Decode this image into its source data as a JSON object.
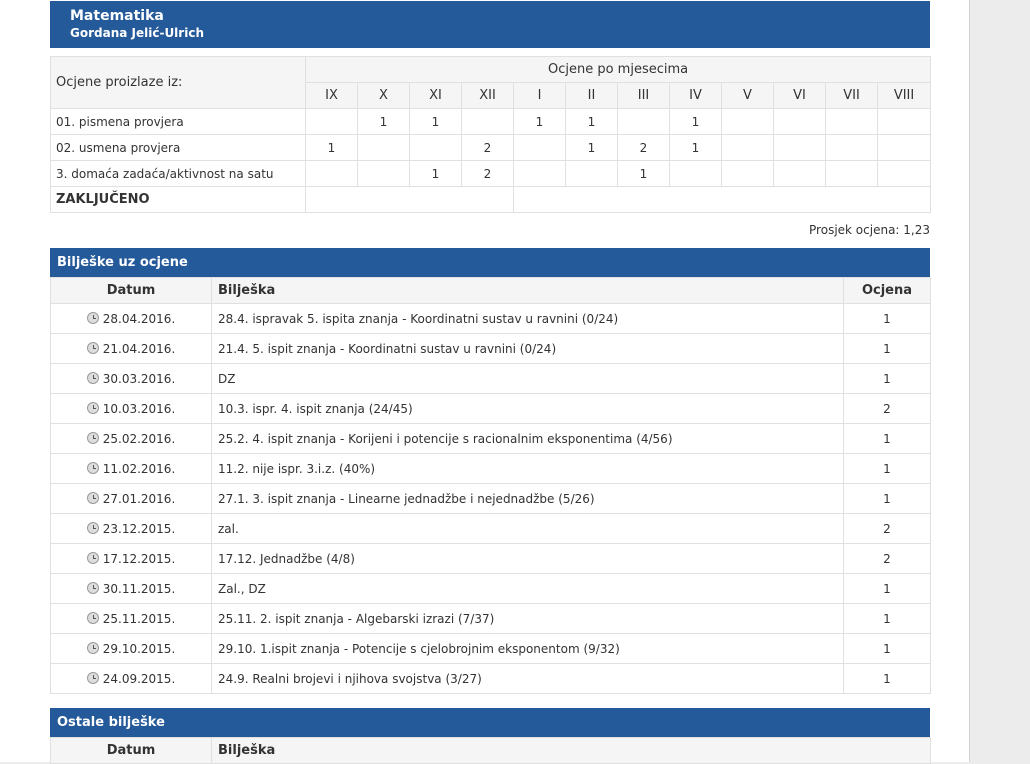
{
  "subject": {
    "name": "Matematika",
    "teacher": "Gordana Jelić-Ulrich"
  },
  "grades": {
    "left_header": "Ocjene proizlaze iz:",
    "top_header": "Ocjene po mjesecima",
    "months": [
      "IX",
      "X",
      "XI",
      "XII",
      "I",
      "II",
      "III",
      "IV",
      "V",
      "VI",
      "VII",
      "VIII"
    ],
    "rows": [
      {
        "label": "01. pismena provjera",
        "cells": [
          "",
          "1",
          "1",
          "",
          "1",
          "1",
          "",
          "1",
          "",
          "",
          "",
          ""
        ]
      },
      {
        "label": "02. usmena provjera",
        "cells": [
          "1",
          "",
          "",
          "2",
          "",
          "1",
          "2",
          "1",
          "",
          "",
          "",
          ""
        ]
      },
      {
        "label": "3. domaća zadaća/aktivnost na satu",
        "cells": [
          "",
          "",
          "1",
          "2",
          "",
          "",
          "1",
          "",
          "",
          "",
          "",
          ""
        ]
      }
    ],
    "final_label": "ZAKLJUČENO"
  },
  "average": "Prosjek ocjena: 1,23",
  "notes": {
    "title": "Bilješke uz ocjene",
    "headers": {
      "date": "Datum",
      "note": "Bilješka",
      "grade": "Ocjena"
    },
    "rows": [
      {
        "date": "28.04.2016.",
        "note": "28.4. ispravak 5. ispita znanja - Koordinatni sustav u ravnini (0/24)",
        "grade": "1"
      },
      {
        "date": "21.04.2016.",
        "note": "21.4. 5. ispit znanja - Koordinatni sustav u ravnini (0/24)",
        "grade": "1"
      },
      {
        "date": "30.03.2016.",
        "note": "DZ",
        "grade": "1"
      },
      {
        "date": "10.03.2016.",
        "note": "10.3. ispr. 4. ispit znanja (24/45)",
        "grade": "2"
      },
      {
        "date": "25.02.2016.",
        "note": "25.2. 4. ispit znanja - Korijeni i potencije s racionalnim eksponentima (4/56)",
        "grade": "1"
      },
      {
        "date": "11.02.2016.",
        "note": "11.2. nije ispr. 3.i.z. (40%)",
        "grade": "1"
      },
      {
        "date": "27.01.2016.",
        "note": "27.1. 3. ispit znanja - Linearne jednadžbe i nejednadžbe (5/26)",
        "grade": "1"
      },
      {
        "date": "23.12.2015.",
        "note": "zal.",
        "grade": "2"
      },
      {
        "date": "17.12.2015.",
        "note": "17.12. Jednadžbe (4/8)",
        "grade": "2"
      },
      {
        "date": "30.11.2015.",
        "note": "Zal., DZ",
        "grade": "1"
      },
      {
        "date": "25.11.2015.",
        "note": "25.11. 2. ispit znanja - Algebarski izrazi (7/37)",
        "grade": "1"
      },
      {
        "date": "29.10.2015.",
        "note": "29.10. 1.ispit znanja - Potencije s cjelobrojnim eksponentom (9/32)",
        "grade": "1"
      },
      {
        "date": "24.09.2015.",
        "note": "24.9. Realni brojevi i njihova svojstva (3/27)",
        "grade": "1"
      }
    ]
  },
  "other_notes": {
    "title": "Ostale bilješke",
    "headers": {
      "date": "Datum",
      "note": "Bilješka"
    }
  }
}
